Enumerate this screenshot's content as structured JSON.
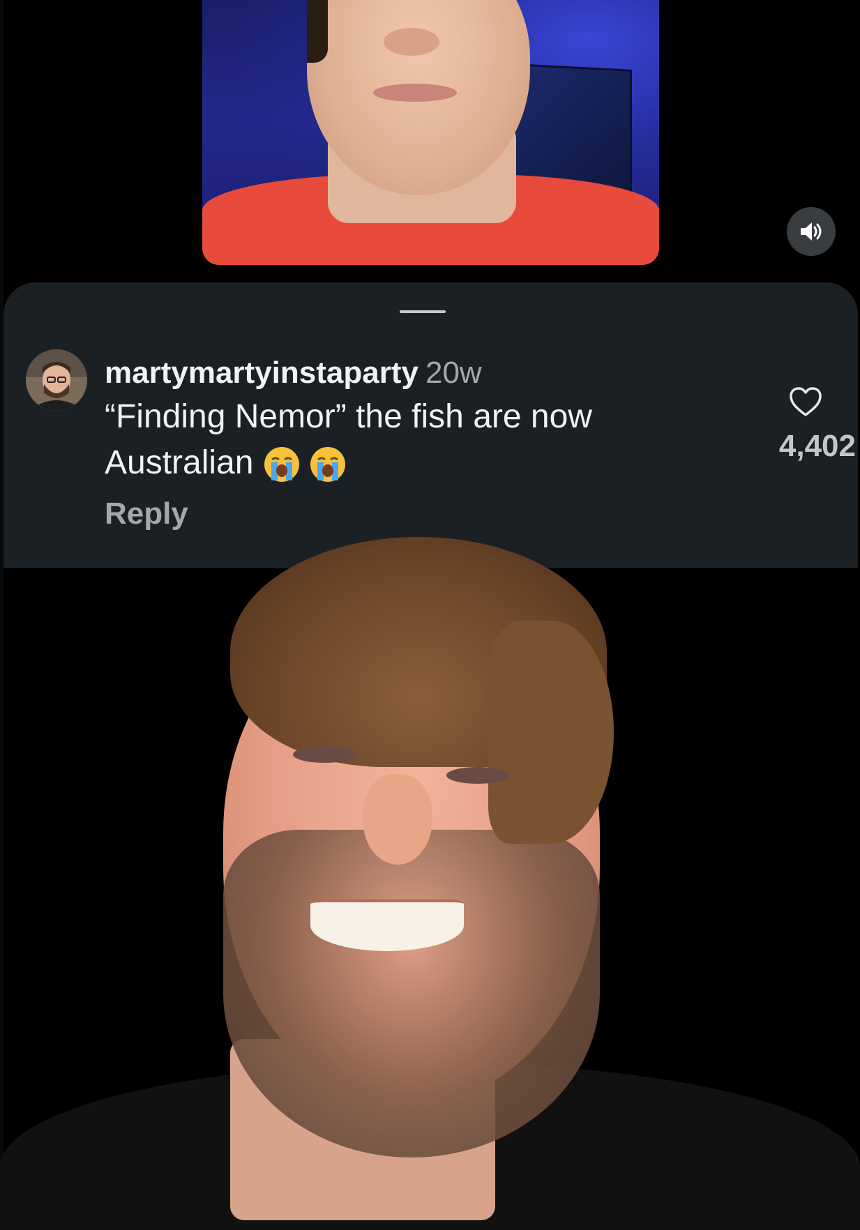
{
  "comment": {
    "username": "martymartyinstaparty",
    "timestamp": "20w",
    "text": "“Finding Nemor” the fish are now Australian",
    "emojis": [
      "loudly-crying-face",
      "loudly-crying-face"
    ],
    "reply_label": "Reply",
    "like_count": "4,402"
  },
  "icons": {
    "mute": "speaker-icon",
    "like": "heart-outline-icon"
  },
  "colors": {
    "sheet_background": "#1b2024",
    "secondary_text": "#a5a8ab",
    "primary_text": "#f2f2f2"
  }
}
